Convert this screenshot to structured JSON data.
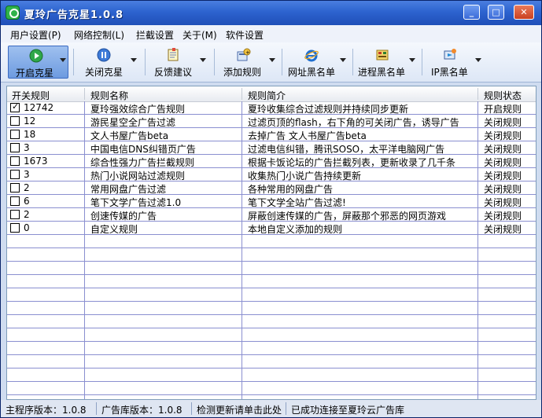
{
  "window": {
    "title": "夏玲广告克星1.0.8",
    "min_glyph": "_",
    "max_glyph": "□",
    "close_glyph": "✕"
  },
  "menu": [
    "用户设置(P)",
    "网络控制(L)",
    "拦截设置",
    "关于(M)",
    "软件设置"
  ],
  "toolbar": [
    {
      "label": "开启克星",
      "icon": "play-icon",
      "active": true
    },
    {
      "label": "关闭克星",
      "icon": "pause-icon"
    },
    {
      "label": "反馈建议",
      "icon": "note-icon"
    },
    {
      "label": "添加规则",
      "icon": "add-rule-icon"
    },
    {
      "label": "网址黑名单",
      "icon": "ie-icon"
    },
    {
      "label": "进程黑名单",
      "icon": "process-icon"
    },
    {
      "label": "IP黑名单",
      "icon": "ip-icon"
    }
  ],
  "columns": [
    "开关规则",
    "规则名称",
    "规则简介",
    "规则状态"
  ],
  "rows": [
    {
      "count": "12742",
      "checked": true,
      "name": "夏玲强效综合广告规则",
      "desc": "夏玲收集综合过滤规则并持续同步更新",
      "status": "开启规则"
    },
    {
      "count": "12",
      "checked": false,
      "name": "游民星空全广告过滤",
      "desc": "过滤页顶的flash，右下角的可关闭广告，诱导广告",
      "status": "关闭规则"
    },
    {
      "count": "18",
      "checked": false,
      "name": "文人书屋广告beta",
      "desc": "去掉广告 文人书屋广告beta",
      "status": "关闭规则"
    },
    {
      "count": "3",
      "checked": false,
      "name": "中国电信DNS纠错页广告",
      "desc": "过滤电信纠错，腾讯SOSO，太平洋电脑网广告",
      "status": "关闭规则"
    },
    {
      "count": "1673",
      "checked": false,
      "name": "综合性强力广告拦截规则",
      "desc": "根据卡饭论坛的广告拦截列表，更新收录了几千条",
      "status": "关闭规则"
    },
    {
      "count": "3",
      "checked": false,
      "name": "热门小说网站过滤规则",
      "desc": "收集热门小说广告持续更新",
      "status": "关闭规则"
    },
    {
      "count": "2",
      "checked": false,
      "name": "常用网盘广告过滤",
      "desc": "各种常用的网盘广告",
      "status": "关闭规则"
    },
    {
      "count": "6",
      "checked": false,
      "name": "笔下文学广告过滤1.0",
      "desc": "笔下文学全站广告过滤!",
      "status": "关闭规则"
    },
    {
      "count": "2",
      "checked": false,
      "name": "创速传媒的广告",
      "desc": "屏蔽创速传媒的广告，屏蔽那个邪恶的网页游戏",
      "status": "关闭规则"
    },
    {
      "count": "0",
      "checked": false,
      "name": "自定义规则",
      "desc": "本地自定义添加的规则",
      "status": "关闭规则"
    }
  ],
  "statusbar": {
    "program_version": "主程序版本：1.0.8",
    "lib_version": "广告库版本：1.0.8",
    "update_hint": "检测更新请单击此处",
    "connection": "已成功连接至夏玲云广告库"
  }
}
